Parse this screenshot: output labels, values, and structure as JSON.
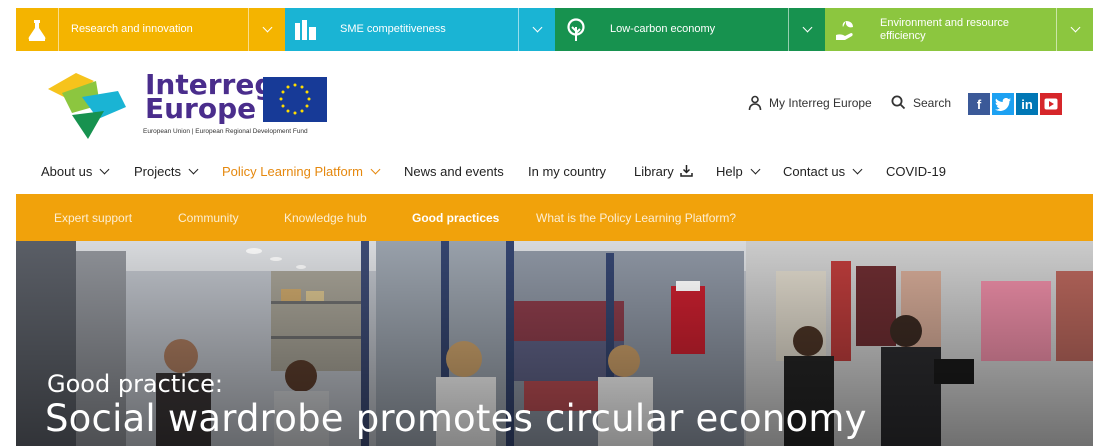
{
  "themes": [
    {
      "label": "Research and innovation",
      "icon": "research-icon",
      "color": "#f4b400"
    },
    {
      "label": "SME competitiveness",
      "icon": "sme-icon",
      "color": "#1ab4d4"
    },
    {
      "label": "Low-carbon economy",
      "icon": "lowcarbon-icon",
      "color": "#17924f"
    },
    {
      "label": "Environment and resource efficiency",
      "icon": "environment-icon",
      "color": "#8cc63f"
    }
  ],
  "logo": {
    "line1": "Interreg",
    "line2": "Europe",
    "subtitle": "European Union | European Regional Development Fund"
  },
  "utility": {
    "my_account": "My Interreg Europe",
    "search": "Search"
  },
  "social": [
    {
      "label": "f",
      "icon": "facebook-icon",
      "color": "#3b5998"
    },
    {
      "label": "t",
      "icon": "twitter-icon",
      "color": "#1da1f2"
    },
    {
      "label": "in",
      "icon": "linkedin-icon",
      "color": "#0077b5"
    },
    {
      "label": "▶",
      "icon": "youtube-icon",
      "color": "#d6262a"
    }
  ],
  "nav": [
    {
      "label": "About us"
    },
    {
      "label": "Projects"
    },
    {
      "label": "Policy Learning Platform"
    },
    {
      "label": "News and events"
    },
    {
      "label": "In my country"
    },
    {
      "label": "Library"
    },
    {
      "label": "Help"
    },
    {
      "label": "Contact us"
    },
    {
      "label": "COVID-19"
    }
  ],
  "subnav": [
    {
      "label": "Expert support"
    },
    {
      "label": "Community"
    },
    {
      "label": "Knowledge hub"
    },
    {
      "label": "Good practices"
    },
    {
      "label": "What is the Policy Learning Platform?"
    }
  ],
  "hero": {
    "kicker": "Good practice:",
    "title": "Social wardrobe promotes circular economy"
  }
}
